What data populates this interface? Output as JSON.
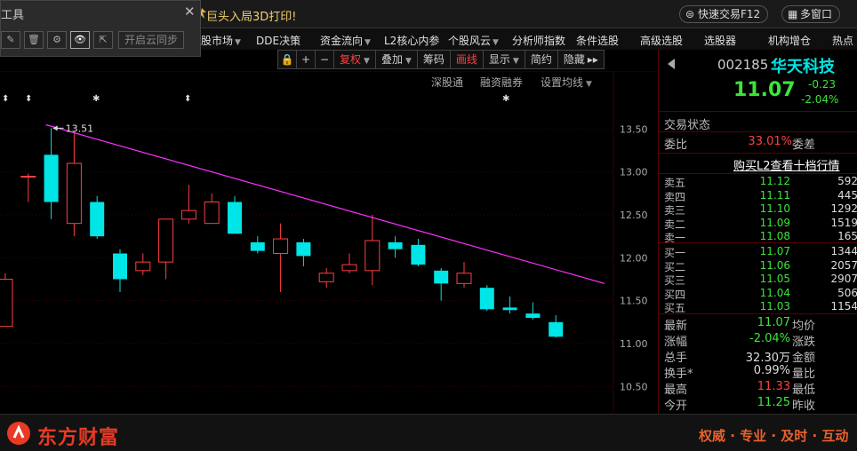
{
  "topbar": {
    "ad_text": "巨头入局3D打印!",
    "trade_label": "快速交易F12",
    "multi_window_label": "多窗口",
    "window_buttons": [
      "−",
      "▢",
      "✕"
    ]
  },
  "tool_panel": {
    "title": "工具",
    "close": "✕",
    "buttons": [
      "✎",
      "🗑",
      "⚙",
      "👁",
      "⇱"
    ],
    "sync_label": "开启云同步"
  },
  "menu": [
    {
      "label": "股市场",
      "caret": true
    },
    {
      "label": "DDE决策",
      "caret": false
    },
    {
      "label": "资金流向",
      "caret": true
    },
    {
      "label": "L2核心内参",
      "caret": false
    },
    {
      "label": "个股风云",
      "caret": true
    },
    {
      "label": "分析师指数",
      "caret": false
    },
    {
      "label": "条件选股",
      "caret": false
    },
    {
      "label": "高级选股",
      "caret": false
    },
    {
      "label": "选股器",
      "caret": false
    },
    {
      "label": "机构增仓",
      "caret": false
    },
    {
      "label": "热点",
      "caret": false
    }
  ],
  "chart_toolbar": {
    "lock": "🔒",
    "plus": "+",
    "minus": "−",
    "fuquan": "复权",
    "diejia": "叠加",
    "chouma": "筹码",
    "huaxian": "画线",
    "xianshi": "显示",
    "jianyue": "简约",
    "yincang": "隐藏",
    "more": "▸▸"
  },
  "sublinks": {
    "shentong": "深股通",
    "rongzi": "融资融券",
    "setma": "设置均线"
  },
  "chart_data": {
    "type": "candlestick",
    "ylim": [
      10.4,
      13.7
    ],
    "yticks": [
      "13.50",
      "13.00",
      "12.50",
      "12.00",
      "11.50",
      "11.00",
      "10.50"
    ],
    "annotation": "13.51",
    "markers": [
      "⬍",
      "⬍",
      "✱",
      "⬍",
      "✱"
    ],
    "candles": [
      {
        "open": 11.2,
        "close": 11.75,
        "high": 11.82,
        "low": 11.2,
        "up": true
      },
      {
        "open": 12.95,
        "close": 12.95,
        "high": 12.98,
        "low": 12.65,
        "up": true
      },
      {
        "open": 12.65,
        "close": 13.2,
        "high": 13.51,
        "low": 12.45,
        "up": false
      },
      {
        "open": 12.4,
        "close": 13.1,
        "high": 13.48,
        "low": 12.25,
        "up": true
      },
      {
        "open": 12.65,
        "close": 12.25,
        "high": 12.72,
        "low": 12.22,
        "up": false
      },
      {
        "open": 12.05,
        "close": 11.75,
        "high": 12.1,
        "low": 11.6,
        "up": false
      },
      {
        "open": 11.85,
        "close": 11.95,
        "high": 12.05,
        "low": 11.8,
        "up": true
      },
      {
        "open": 11.95,
        "close": 12.45,
        "high": 12.45,
        "low": 11.75,
        "up": true
      },
      {
        "open": 12.45,
        "close": 12.55,
        "high": 12.85,
        "low": 12.4,
        "up": true
      },
      {
        "open": 12.4,
        "close": 12.65,
        "high": 12.75,
        "low": 12.4,
        "up": true
      },
      {
        "open": 12.65,
        "close": 12.28,
        "high": 12.72,
        "low": 12.28,
        "up": false
      },
      {
        "open": 12.18,
        "close": 12.08,
        "high": 12.25,
        "low": 12.05,
        "up": false
      },
      {
        "open": 12.05,
        "close": 12.22,
        "high": 12.4,
        "low": 11.6,
        "up": true
      },
      {
        "open": 12.18,
        "close": 12.02,
        "high": 12.22,
        "low": 11.9,
        "up": false
      },
      {
        "open": 11.72,
        "close": 11.82,
        "high": 11.88,
        "low": 11.65,
        "up": true
      },
      {
        "open": 11.85,
        "close": 11.92,
        "high": 12.05,
        "low": 11.82,
        "up": true
      },
      {
        "open": 11.85,
        "close": 12.2,
        "high": 12.5,
        "low": 11.68,
        "up": true
      },
      {
        "open": 12.18,
        "close": 12.1,
        "high": 12.25,
        "low": 12.0,
        "up": false
      },
      {
        "open": 12.15,
        "close": 11.92,
        "high": 12.22,
        "low": 11.9,
        "up": false
      },
      {
        "open": 11.85,
        "close": 11.7,
        "high": 11.88,
        "low": 11.5,
        "up": false
      },
      {
        "open": 11.7,
        "close": 11.82,
        "high": 11.95,
        "low": 11.65,
        "up": true
      },
      {
        "open": 11.65,
        "close": 11.4,
        "high": 11.68,
        "low": 11.38,
        "up": false
      },
      {
        "open": 11.42,
        "close": 11.39,
        "high": 11.55,
        "low": 11.35,
        "up": false
      },
      {
        "open": 11.35,
        "close": 11.3,
        "high": 11.48,
        "low": 11.28,
        "up": false
      },
      {
        "open": 11.25,
        "close": 11.08,
        "high": 11.33,
        "low": 11.07,
        "up": false
      }
    ],
    "trendline": {
      "from": 13.55,
      "to": 11.7,
      "color": "#ff30ff"
    },
    "colors": {
      "up": "#ff4040",
      "down": "#00e5e5",
      "grid": "#3a0000"
    }
  },
  "stock": {
    "code": "002185",
    "name": "华天科技",
    "price": "11.07",
    "change": "-0.23",
    "pct": "-2.04%"
  },
  "panel": {
    "status_label": "交易状态",
    "weibi_label": "委比",
    "weibi_val": "33.01%",
    "weicha_label": "委差",
    "l2_link": "购买L2查看十档行情",
    "asks": [
      {
        "label": "卖五",
        "price": "11.12",
        "vol": "592"
      },
      {
        "label": "卖四",
        "price": "11.11",
        "vol": "445"
      },
      {
        "label": "卖三",
        "price": "11.10",
        "vol": "1292"
      },
      {
        "label": "卖二",
        "price": "11.09",
        "vol": "1519"
      },
      {
        "label": "卖一",
        "price": "11.08",
        "vol": "165"
      }
    ],
    "bids": [
      {
        "label": "买一",
        "price": "11.07",
        "vol": "1344"
      },
      {
        "label": "买二",
        "price": "11.06",
        "vol": "2057"
      },
      {
        "label": "买三",
        "price": "11.05",
        "vol": "2907"
      },
      {
        "label": "买四",
        "price": "11.04",
        "vol": "506"
      },
      {
        "label": "买五",
        "price": "11.03",
        "vol": "1154"
      }
    ],
    "stats": [
      {
        "l1": "最新",
        "v1": "11.07",
        "c1": "#39e639",
        "l2": "均价"
      },
      {
        "l1": "涨幅",
        "v1": "-2.04%",
        "c1": "#39e639",
        "l2": "涨跌"
      },
      {
        "l1": "总手",
        "v1": "32.30万",
        "c1": "#dddddd",
        "l2": "金额"
      },
      {
        "l1": "换手*",
        "v1": "0.99%",
        "c1": "#dddddd",
        "l2": "量比"
      },
      {
        "l1": "最高",
        "v1": "11.33",
        "c1": "#ff4040",
        "l2": "最低"
      },
      {
        "l1": "今开",
        "v1": "11.25",
        "c1": "#39e639",
        "l2": "昨收"
      }
    ]
  },
  "bottom": {
    "logo_text": "东方财富",
    "slogan": "权威 · 专业 · 及时 · 互动"
  }
}
